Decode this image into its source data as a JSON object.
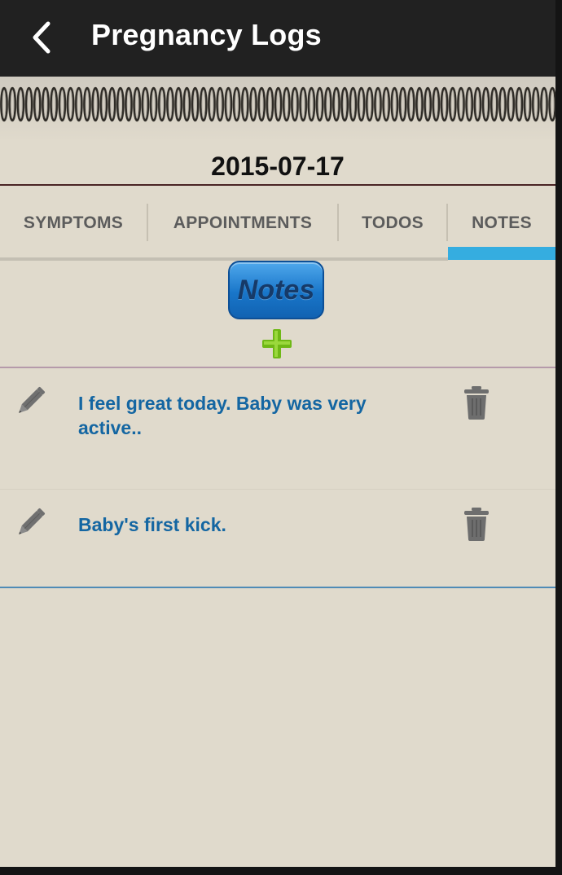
{
  "app_bar": {
    "title": "Pregnancy Logs",
    "back_icon": "chevron-left-icon"
  },
  "date": "2015-07-17",
  "tabs": [
    {
      "label": "SYMPTOMS",
      "selected": false
    },
    {
      "label": "APPOINTMENTS",
      "selected": false
    },
    {
      "label": "TODOS",
      "selected": false
    },
    {
      "label": "NOTES",
      "selected": true
    }
  ],
  "section": {
    "badge_label": "Notes",
    "add_icon": "plus-icon"
  },
  "notes": [
    {
      "text": "I feel great today. Baby was very active..",
      "edit_icon": "pencil-icon",
      "delete_icon": "trash-icon"
    },
    {
      "text": "Baby's first kick.",
      "edit_icon": "pencil-icon",
      "delete_icon": "trash-icon"
    }
  ],
  "colors": {
    "app_bar": "#212121",
    "background": "#e0dacc",
    "tab_indicator": "#35ade0",
    "note_text": "#1466a2",
    "add_icon": "#7cc21c",
    "badge": "#1976c9"
  }
}
